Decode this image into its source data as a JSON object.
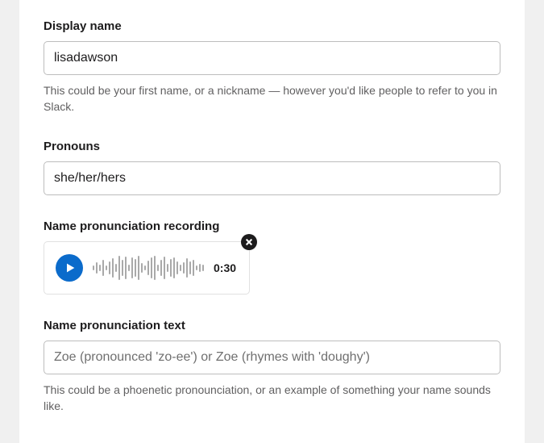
{
  "displayName": {
    "label": "Display name",
    "value": "lisadawson",
    "helper": "This could be your first name, or a nickname — however you'd like people to refer to you in Slack."
  },
  "pronouns": {
    "label": "Pronouns",
    "value": "she/her/hers"
  },
  "recording": {
    "label": "Name pronunciation recording",
    "duration": "0:30",
    "waveform_bars": [
      6,
      14,
      8,
      20,
      6,
      16,
      24,
      10,
      30,
      20,
      28,
      8,
      26,
      22,
      30,
      12,
      6,
      18,
      26,
      30,
      8,
      20,
      28,
      10,
      22,
      26,
      16,
      8,
      14,
      24,
      16,
      20,
      6,
      10,
      8
    ]
  },
  "pronunciationText": {
    "label": "Name pronunciation text",
    "placeholder": "Zoe (pronounced 'zo-ee') or Zoe (rhymes with 'doughy')",
    "helper": "This could be a phoenetic pronounciation, or an example of something your name sounds like."
  }
}
